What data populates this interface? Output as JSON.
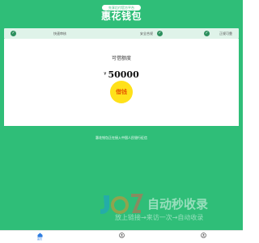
{
  "header": {
    "tag": "先享后付官方平台",
    "title": "惠花钱包"
  },
  "features": [
    {
      "label": "快速审核",
      "icon": "check-circle-icon"
    },
    {
      "label": "安全合规",
      "icon": "check-circle-icon"
    },
    {
      "label": "正规可靠",
      "icon": "check-circle-icon"
    }
  ],
  "quota": {
    "label": "可借额度",
    "currency": "¥",
    "amount": "50000"
  },
  "borrow_button": {
    "label": "借钱"
  },
  "footnote": "惠花钱包正在接入中国人民银行征信",
  "watermark": {
    "title": "自动秒收录",
    "subtitle": "放上链接→来访一次→自动收录",
    "logo": "jz-logo-icon"
  },
  "nav": {
    "tabs": [
      {
        "label": "首页",
        "icon": "home-icon",
        "active": true
      },
      {
        "label": "",
        "icon": "user-icon",
        "active": false
      },
      {
        "label": "",
        "icon": "user-icon",
        "active": false
      }
    ]
  },
  "colors": {
    "brand_green": "#2fbe78",
    "feature_strip": "#dff3e9",
    "button_yellow": "#ffe11a",
    "button_text": "#e65a00",
    "active_tab": "#2f7de0"
  }
}
